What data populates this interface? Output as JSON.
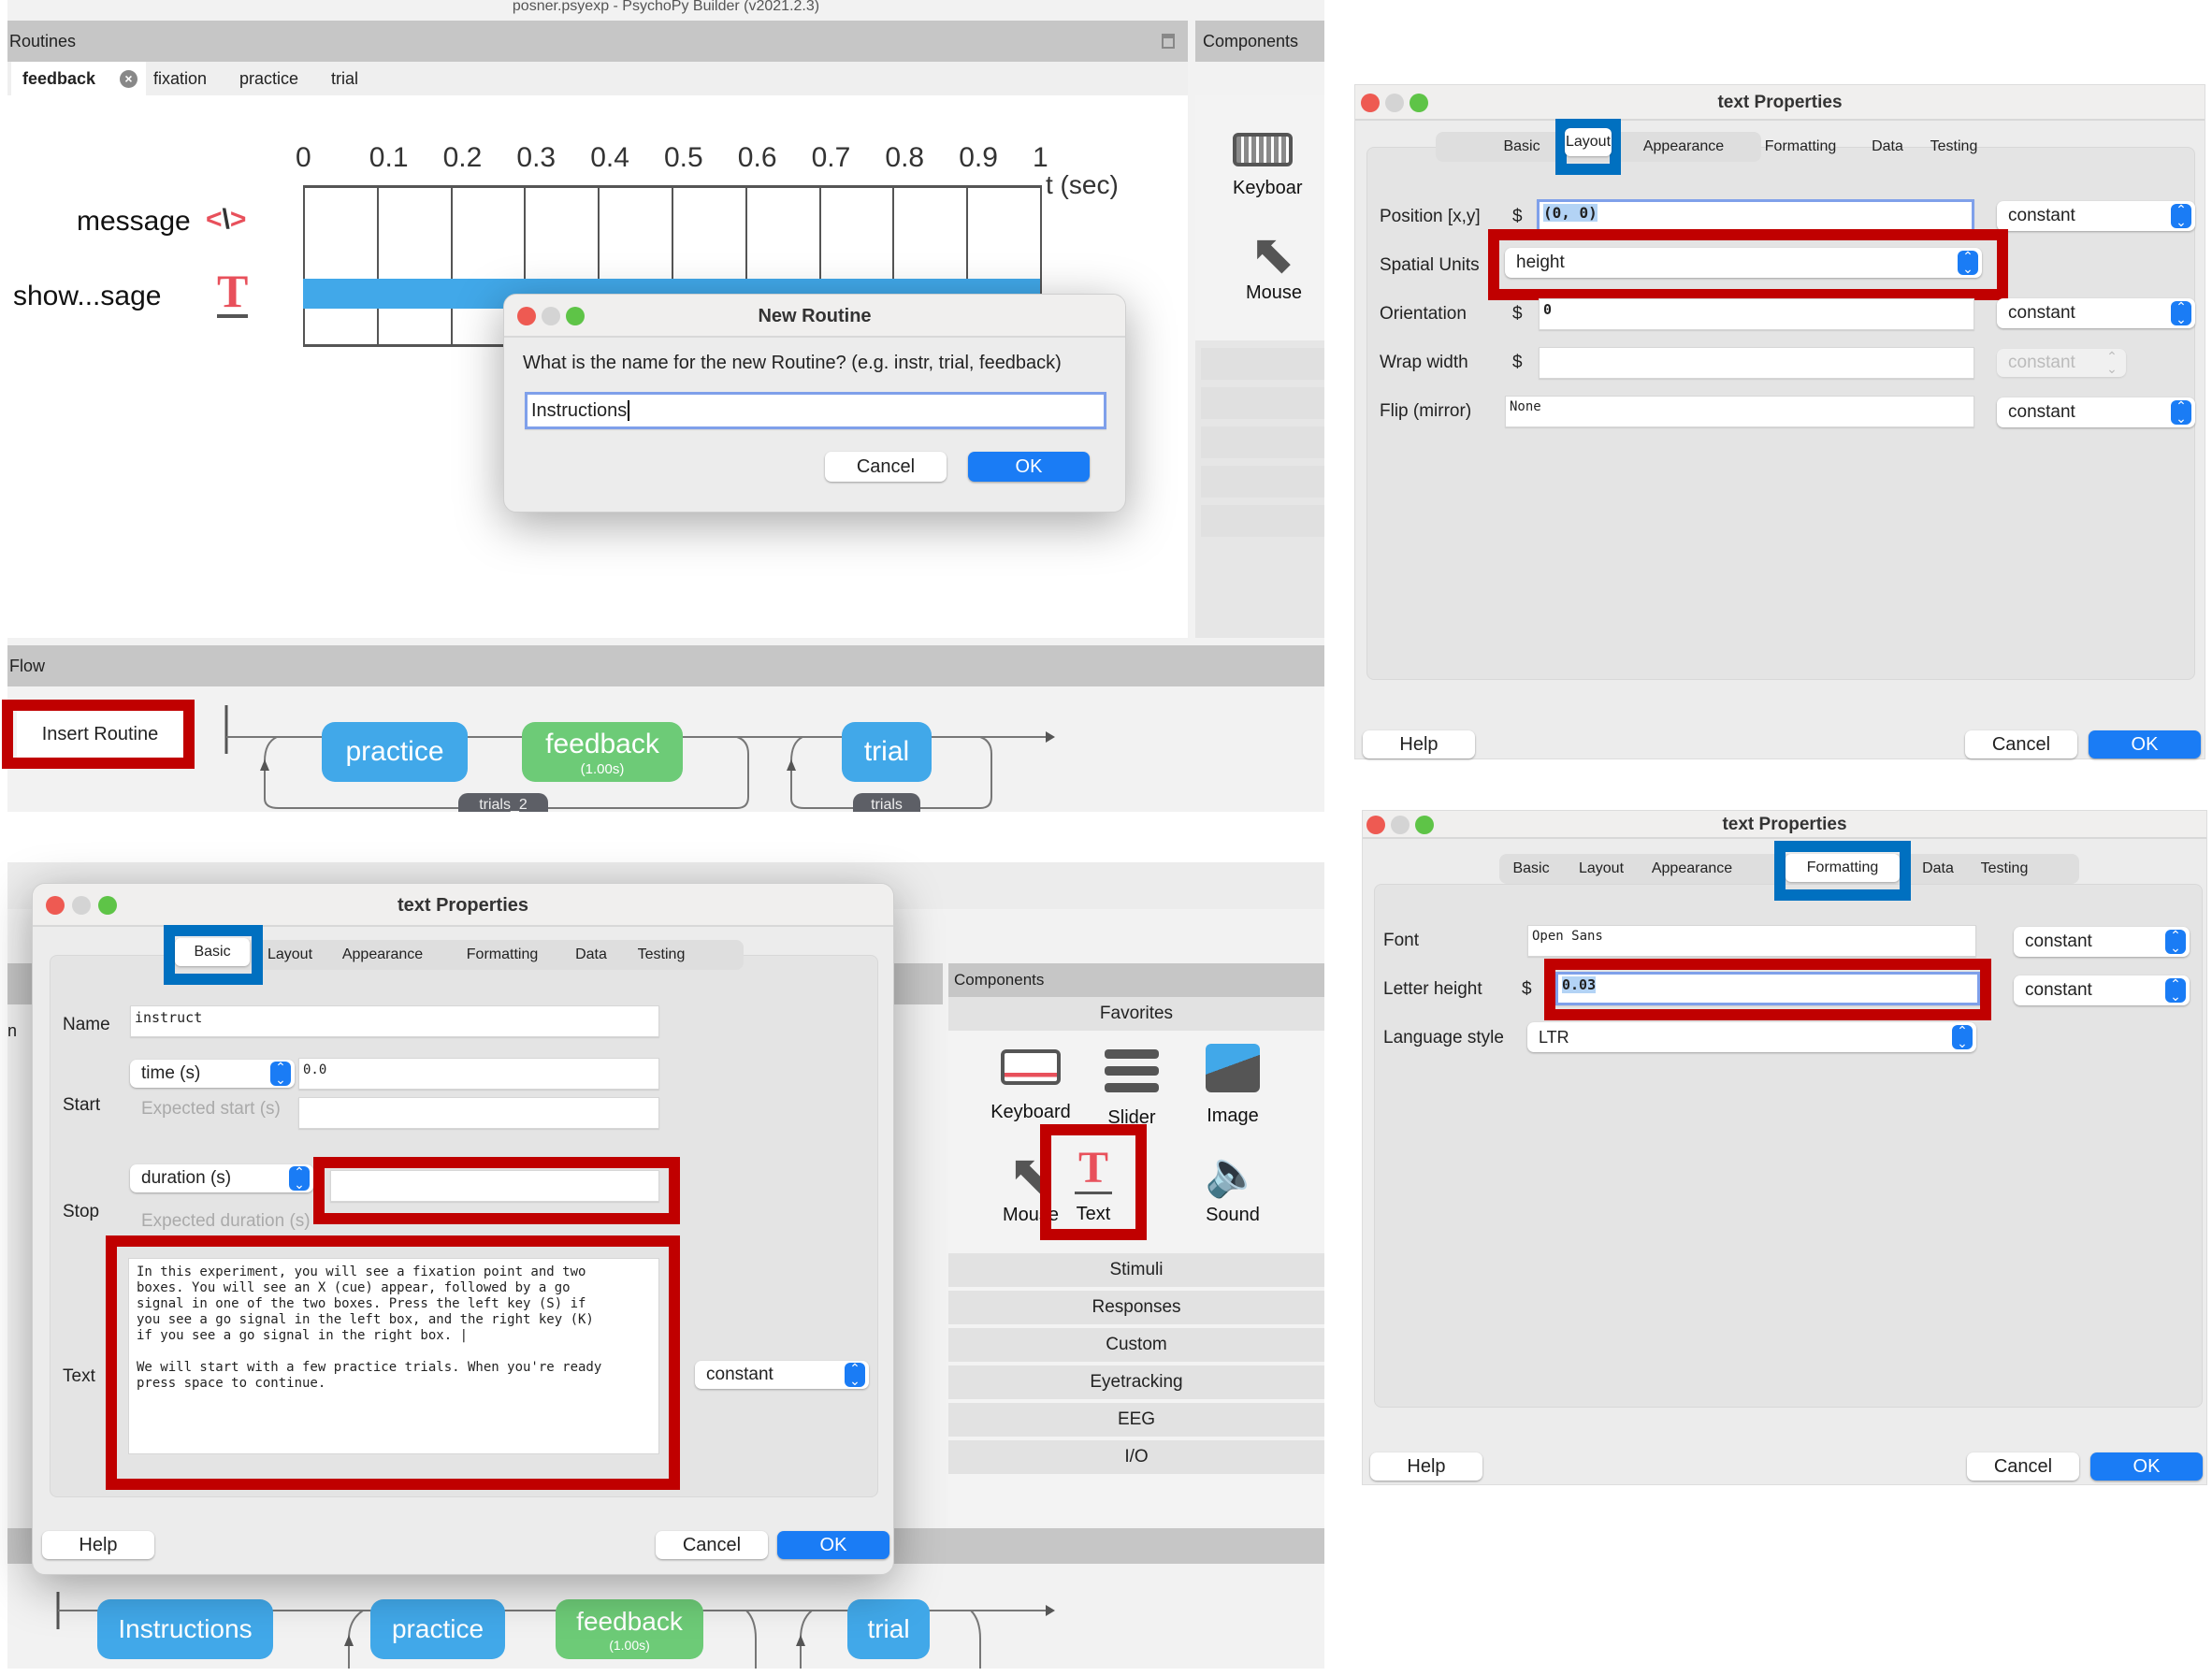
{
  "panel1": {
    "window_title": "posner.psyexp - PsychoPy Builder (v2021.2.3)",
    "routines_header": "Routines",
    "components_header": "Components",
    "routine_tabs": [
      {
        "label": "feedback",
        "active": true
      },
      {
        "label": "fixation"
      },
      {
        "label": "practice"
      },
      {
        "label": "trial"
      }
    ],
    "timeline": {
      "ticks": [
        "0",
        "0.1",
        "0.2",
        "0.3",
        "0.4",
        "0.5",
        "0.6",
        "0.7",
        "0.8",
        "0.9",
        "1"
      ],
      "axis_label": "t (sec)",
      "rows": [
        {
          "label": "message",
          "icon": "code-icon"
        },
        {
          "label": "show...sage",
          "icon": "text-icon",
          "bar_start": 0.0,
          "bar_end": 1.0
        }
      ]
    },
    "side_components": [
      {
        "label": "Keyboar",
        "icon": "keyboard-icon"
      },
      {
        "label": "Mouse",
        "icon": "mouse-icon"
      }
    ],
    "new_routine_dialog": {
      "title": "New Routine",
      "prompt": "What is the name for the new Routine? (e.g. instr, trial, feedback)",
      "input_value": "Instructions",
      "cancel": "Cancel",
      "ok": "OK"
    },
    "flow": {
      "header": "Flow",
      "insert_routine": "Insert Routine",
      "nodes": [
        {
          "label": "practice",
          "color": "#41a8e9"
        },
        {
          "label": "feedback",
          "sub": "(1.00s)",
          "color": "#6dcb77"
        },
        {
          "label": "trial",
          "color": "#41a8e9"
        }
      ],
      "loops": [
        "trials_2",
        "trials"
      ]
    }
  },
  "panel2": {
    "title": "text Properties",
    "tabs": [
      "Basic",
      "Layout",
      "Appearance",
      "Formatting",
      "Data",
      "Testing"
    ],
    "active_tab": "Layout",
    "fields": {
      "position_label": "Position [x,y]",
      "position_value": "(0, 0)",
      "position_mode": "constant",
      "units_label": "Spatial Units",
      "units_value": "height",
      "orientation_label": "Orientation",
      "orientation_value": "0",
      "orientation_mode": "constant",
      "wrap_label": "Wrap width",
      "wrap_value": "",
      "wrap_mode": "constant",
      "flip_label": "Flip (mirror)",
      "flip_value": "None",
      "flip_mode": "constant",
      "dollar": "$"
    },
    "help": "Help",
    "cancel": "Cancel",
    "ok": "OK"
  },
  "panel3": {
    "title": "text Properties",
    "tabs": [
      "Basic",
      "Layout",
      "Appearance",
      "Formatting",
      "Data",
      "Testing"
    ],
    "active_tab": "Basic",
    "name_label": "Name",
    "name_value": "instruct",
    "start_label": "Start",
    "start_type": "time (s)",
    "start_value": "0.0",
    "expected_start_label": "Expected start (s)",
    "stop_label": "Stop",
    "stop_type": "duration (s)",
    "stop_value": "",
    "expected_duration_label": "Expected duration (s)",
    "text_label": "Text",
    "text_value": "In this experiment, you will see a fixation point and two\nboxes. You will see an X (cue) appear, followed by a go\nsignal in one of the two boxes. Press the left key (S) if\nyou see a go signal in the left box, and the right key (K)\nif you see a go signal in the right box. |\n\nWe will start with a few practice trials. When you're ready\npress space to continue.",
    "text_mode": "constant",
    "help": "Help",
    "cancel": "Cancel",
    "ok": "OK",
    "bg_left_letter": "n",
    "components": {
      "header": "Components",
      "favorites": "Favorites",
      "items": [
        {
          "label": "Keyboard",
          "icon": "keyboard-icon"
        },
        {
          "label": "Slider",
          "icon": "slider-icon"
        },
        {
          "label": "Image",
          "icon": "image-icon"
        },
        {
          "label": "Mouse",
          "icon": "mouse-icon"
        },
        {
          "label": "Text",
          "icon": "text-icon"
        },
        {
          "label": "Sound",
          "icon": "sound-icon"
        }
      ],
      "categories": [
        "Stimuli",
        "Responses",
        "Custom",
        "Eyetracking",
        "EEG",
        "I/O"
      ]
    },
    "flow_nodes": [
      {
        "label": "Instructions",
        "color": "#41a8e9"
      },
      {
        "label": "practice",
        "color": "#41a8e9"
      },
      {
        "label": "feedback",
        "sub": "(1.00s)",
        "color": "#6dcb77"
      },
      {
        "label": "trial",
        "color": "#41a8e9"
      }
    ]
  },
  "panel4": {
    "title": "text Properties",
    "tabs": [
      "Basic",
      "Layout",
      "Appearance",
      "Formatting",
      "Data",
      "Testing"
    ],
    "active_tab": "Formatting",
    "font_label": "Font",
    "font_value": "Open Sans",
    "font_mode": "constant",
    "letter_height_label": "Letter height",
    "letter_height_value": "0.03",
    "letter_height_mode": "constant",
    "language_label": "Language style",
    "language_value": "LTR",
    "dollar": "$",
    "help": "Help",
    "cancel": "Cancel",
    "ok": "OK"
  },
  "colors": {
    "highlight_red": "#c00000",
    "highlight_blue": "#0070c0",
    "ok_blue": "#1a7cf5",
    "routine_blue": "#41a8e9",
    "routine_green": "#6dcb77",
    "text_icon_red": "#e8505b"
  }
}
